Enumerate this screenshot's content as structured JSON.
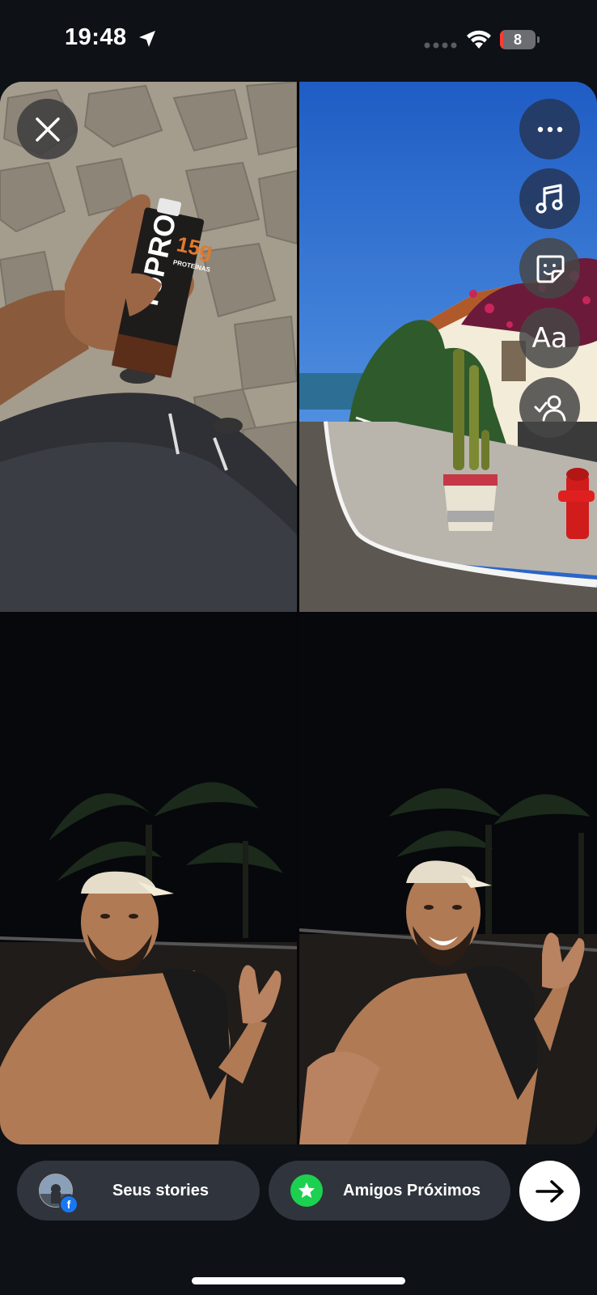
{
  "status_bar": {
    "time": "19:48",
    "battery_level": "8",
    "battery_color": "#ff3b30"
  },
  "photos": [
    {
      "name": "photo-yopro-drink",
      "description_icon": "photo"
    },
    {
      "name": "photo-street-cactus",
      "description_icon": "photo"
    },
    {
      "name": "photo-night-selfie-1",
      "description_icon": "photo"
    },
    {
      "name": "photo-night-selfie-2",
      "description_icon": "photo"
    }
  ],
  "product": {
    "brand": "YoPRO",
    "protein": "15g",
    "protein_label": "PROTEÍNAS"
  },
  "toolbar": {
    "close_icon": "close-icon",
    "more_icon": "more-icon",
    "music_icon": "music-icon",
    "sticker_icon": "sticker-icon",
    "text_label": "Aa",
    "mention_icon": "mention-icon"
  },
  "bottom_bar": {
    "stories_label": "Seus stories",
    "close_friends_label": "Amigos Próximos",
    "next_icon": "arrow-right-icon",
    "close_friends_color": "#1cd14f",
    "facebook_color": "#1877f2"
  }
}
